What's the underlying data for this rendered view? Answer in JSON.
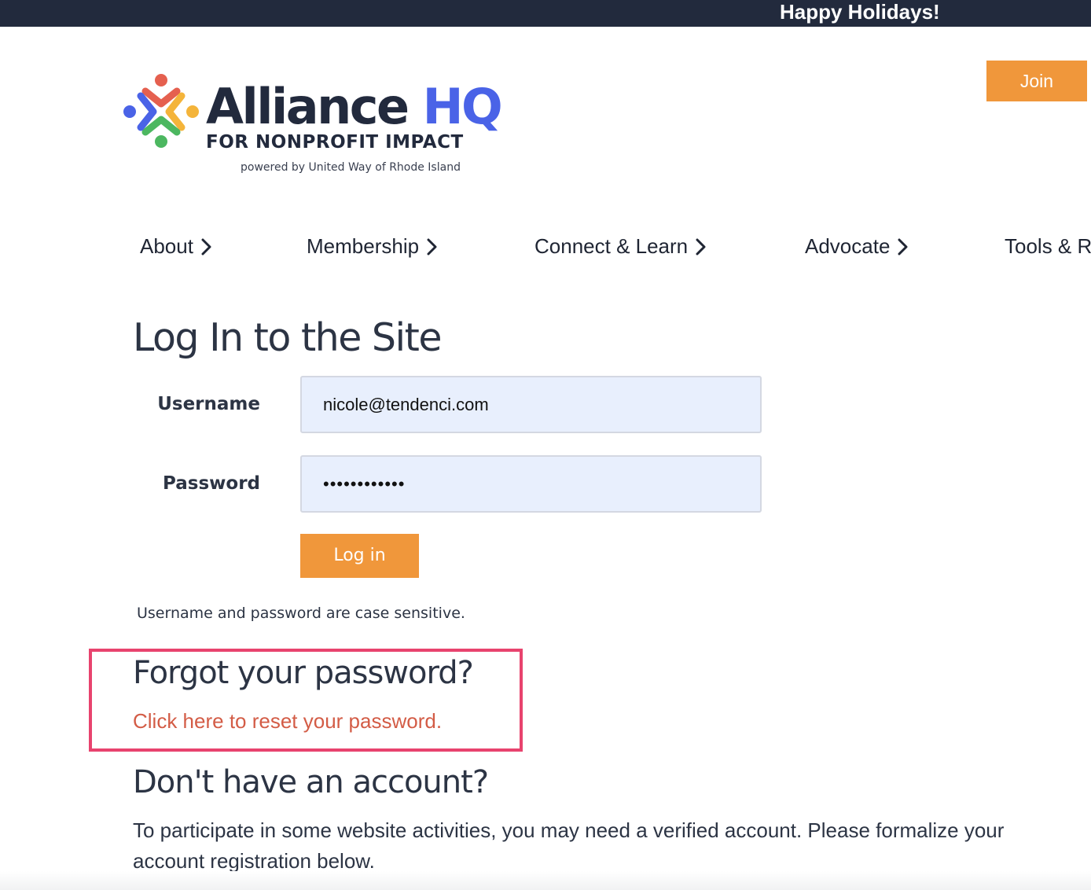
{
  "topbar": {
    "announcement": "Happy Holidays!"
  },
  "header": {
    "join_label": "Join",
    "logo": {
      "name_main": "Alliance",
      "name_accent": "HQ",
      "tagline": "FOR NONPROFIT IMPACT",
      "powered_by": "powered by United Way of Rhode Island",
      "colors": {
        "dark": "#222a3d",
        "accent": "#4a63e7",
        "red": "#e5604f",
        "yellow": "#f4b43a",
        "green": "#4cb760",
        "blue": "#4a63e7"
      }
    }
  },
  "nav": {
    "items": [
      {
        "label": "About",
        "icon": "chevron-right-icon"
      },
      {
        "label": "Membership",
        "icon": "chevron-right-icon"
      },
      {
        "label": "Connect & Learn",
        "icon": "chevron-right-icon"
      },
      {
        "label": "Advocate",
        "icon": "chevron-right-icon"
      },
      {
        "label": "Tools & R"
      }
    ]
  },
  "login": {
    "title": "Log In to the Site",
    "username_label": "Username",
    "username_value": "nicole@tendenci.com",
    "password_label": "Password",
    "password_value": "••••••••••••",
    "submit_label": "Log in",
    "case_note": "Username and password are case sensitive."
  },
  "forgot": {
    "heading": "Forgot your password?",
    "link_text": "Click here to reset your password."
  },
  "signup": {
    "heading": "Don't have an account?",
    "body": "To participate in some website activities, you may need a verified account. Please formalize your account registration below."
  },
  "colors": {
    "topbar_bg": "#222a3d",
    "button_orange": "#f0973b",
    "link_red": "#d35c46",
    "highlight_pink": "#e8436e",
    "input_bg": "#e8effd"
  }
}
